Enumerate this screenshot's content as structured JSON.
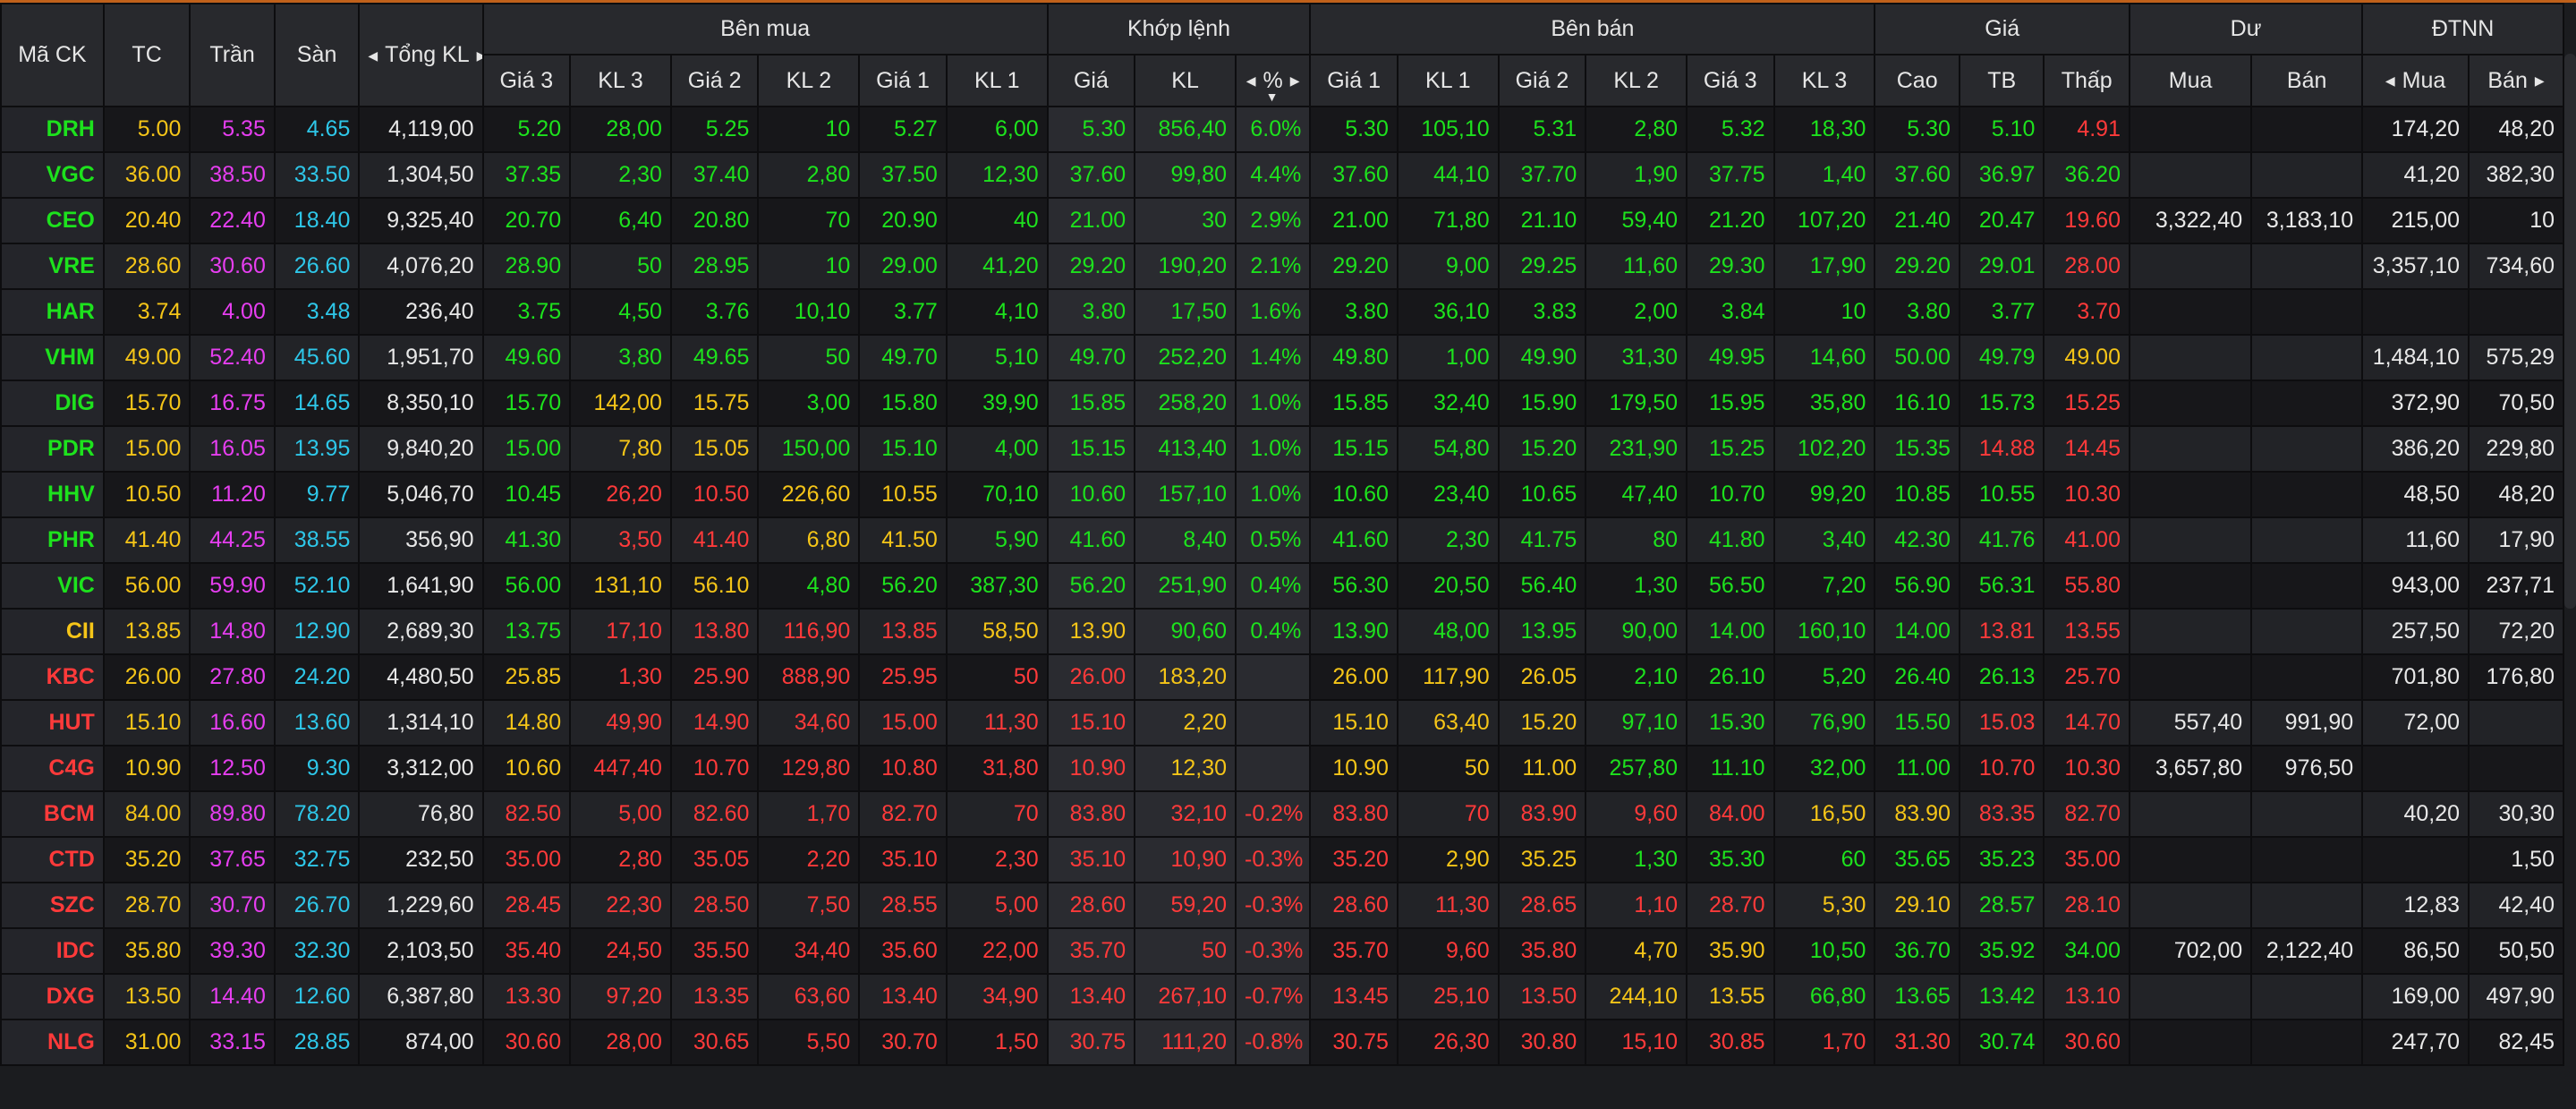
{
  "headers": {
    "symbol": "Mã CK",
    "ref": "TC",
    "ceiling": "Trần",
    "floor": "Sàn",
    "total_vol": "Tổng KL",
    "buy_side": "Bên mua",
    "matched": "Khớp lệnh",
    "sell_side": "Bên bán",
    "price": "Giá",
    "residual": "Dư",
    "foreign": "ĐTNN",
    "buy_cols": [
      "Giá 3",
      "KL 3",
      "Giá 2",
      "KL 2",
      "Giá 1",
      "KL 1"
    ],
    "match_cols": [
      "Giá",
      "KL",
      "%"
    ],
    "sell_cols": [
      "Giá 1",
      "KL 1",
      "Giá 2",
      "KL 2",
      "Giá 3",
      "KL 3"
    ],
    "price_cols": [
      "Cao",
      "TB",
      "Thấp"
    ],
    "residual_cols": [
      "Mua",
      "Bán"
    ],
    "foreign_cols": [
      "Mua",
      "Bán"
    ]
  },
  "icons": {
    "arrow_left": "◀",
    "arrow_right": "▶",
    "sort_down": "▼"
  },
  "colors": {
    "up": "#1de21d",
    "down": "#ff3a3a",
    "reference": "#f5c518",
    "ceiling": "#e63ef0",
    "floor": "#2ec7e9",
    "neutral": "#e8e8e8"
  },
  "rows": [
    {
      "sym": "DRH",
      "tc": "5.00",
      "tran": "5.35",
      "san": "4.65",
      "tong_kl": "4,119,00",
      "b3p": "5.20",
      "b3v": "28,00",
      "b2p": "5.25",
      "b2v": "10",
      "b1p": "5.27",
      "b1v": "6,00",
      "mp": "5.30",
      "mv": "856,40",
      "pct": "6.0%",
      "s1p": "5.30",
      "s1v": "105,10",
      "s2p": "5.31",
      "s2v": "2,80",
      "s3p": "5.32",
      "s3v": "18,30",
      "cao": "5.30",
      "tb": "5.10",
      "thap": "4.91",
      "du_mua": "",
      "du_ban": "",
      "nn_mua": "174,20",
      "nn_ban": "48,20",
      "c": [
        "u",
        "u",
        "u",
        "u",
        "u",
        "u",
        "u",
        "u",
        "u",
        "u",
        "u",
        "u",
        "u",
        "u",
        "u",
        "u",
        "u",
        "d"
      ]
    },
    {
      "sym": "VGC",
      "tc": "36.00",
      "tran": "38.50",
      "san": "33.50",
      "tong_kl": "1,304,50",
      "b3p": "37.35",
      "b3v": "2,30",
      "b2p": "37.40",
      "b2v": "2,80",
      "b1p": "37.50",
      "b1v": "12,30",
      "mp": "37.60",
      "mv": "99,80",
      "pct": "4.4%",
      "s1p": "37.60",
      "s1v": "44,10",
      "s2p": "37.70",
      "s2v": "1,90",
      "s3p": "37.75",
      "s3v": "1,40",
      "cao": "37.60",
      "tb": "36.97",
      "thap": "36.20",
      "du_mua": "",
      "du_ban": "",
      "nn_mua": "41,20",
      "nn_ban": "382,30",
      "c": [
        "u",
        "u",
        "u",
        "u",
        "u",
        "u",
        "u",
        "u",
        "u",
        "u",
        "u",
        "u",
        "u",
        "u",
        "u",
        "u",
        "u",
        "u"
      ]
    },
    {
      "sym": "CEO",
      "tc": "20.40",
      "tran": "22.40",
      "san": "18.40",
      "tong_kl": "9,325,40",
      "b3p": "20.70",
      "b3v": "6,40",
      "b2p": "20.80",
      "b2v": "70",
      "b1p": "20.90",
      "b1v": "40",
      "mp": "21.00",
      "mv": "30",
      "pct": "2.9%",
      "s1p": "21.00",
      "s1v": "71,80",
      "s2p": "21.10",
      "s2v": "59,40",
      "s3p": "21.20",
      "s3v": "107,20",
      "cao": "21.40",
      "tb": "20.47",
      "thap": "19.60",
      "du_mua": "3,322,40",
      "du_ban": "3,183,10",
      "nn_mua": "215,00",
      "nn_ban": "10",
      "c": [
        "u",
        "u",
        "u",
        "u",
        "u",
        "u",
        "u",
        "u",
        "u",
        "u",
        "u",
        "u",
        "u",
        "u",
        "u",
        "u",
        "u",
        "d"
      ]
    },
    {
      "sym": "VRE",
      "tc": "28.60",
      "tran": "30.60",
      "san": "26.60",
      "tong_kl": "4,076,20",
      "b3p": "28.90",
      "b3v": "50",
      "b2p": "28.95",
      "b2v": "10",
      "b1p": "29.00",
      "b1v": "41,20",
      "mp": "29.20",
      "mv": "190,20",
      "pct": "2.1%",
      "s1p": "29.20",
      "s1v": "9,00",
      "s2p": "29.25",
      "s2v": "11,60",
      "s3p": "29.30",
      "s3v": "17,90",
      "cao": "29.20",
      "tb": "29.01",
      "thap": "28.00",
      "du_mua": "",
      "du_ban": "",
      "nn_mua": "3,357,10",
      "nn_ban": "734,60",
      "c": [
        "u",
        "u",
        "u",
        "u",
        "u",
        "u",
        "u",
        "u",
        "u",
        "u",
        "u",
        "u",
        "u",
        "u",
        "u",
        "u",
        "u",
        "d"
      ]
    },
    {
      "sym": "HAR",
      "tc": "3.74",
      "tran": "4.00",
      "san": "3.48",
      "tong_kl": "236,40",
      "b3p": "3.75",
      "b3v": "4,50",
      "b2p": "3.76",
      "b2v": "10,10",
      "b1p": "3.77",
      "b1v": "4,10",
      "mp": "3.80",
      "mv": "17,50",
      "pct": "1.6%",
      "s1p": "3.80",
      "s1v": "36,10",
      "s2p": "3.83",
      "s2v": "2,00",
      "s3p": "3.84",
      "s3v": "10",
      "cao": "3.80",
      "tb": "3.77",
      "thap": "3.70",
      "du_mua": "",
      "du_ban": "",
      "nn_mua": "",
      "nn_ban": "",
      "c": [
        "u",
        "u",
        "u",
        "u",
        "u",
        "u",
        "u",
        "u",
        "u",
        "u",
        "u",
        "u",
        "u",
        "u",
        "u",
        "u",
        "u",
        "d"
      ]
    },
    {
      "sym": "VHM",
      "tc": "49.00",
      "tran": "52.40",
      "san": "45.60",
      "tong_kl": "1,951,70",
      "b3p": "49.60",
      "b3v": "3,80",
      "b2p": "49.65",
      "b2v": "50",
      "b1p": "49.70",
      "b1v": "5,10",
      "mp": "49.70",
      "mv": "252,20",
      "pct": "1.4%",
      "s1p": "49.80",
      "s1v": "1,00",
      "s2p": "49.90",
      "s2v": "31,30",
      "s3p": "49.95",
      "s3v": "14,60",
      "cao": "50.00",
      "tb": "49.79",
      "thap": "49.00",
      "du_mua": "",
      "du_ban": "",
      "nn_mua": "1,484,10",
      "nn_ban": "575,29",
      "c": [
        "u",
        "u",
        "u",
        "u",
        "u",
        "u",
        "u",
        "u",
        "u",
        "u",
        "u",
        "u",
        "u",
        "u",
        "u",
        "u",
        "u",
        "r"
      ]
    },
    {
      "sym": "DIG",
      "tc": "15.70",
      "tran": "16.75",
      "san": "14.65",
      "tong_kl": "8,350,10",
      "b3p": "15.70",
      "b3v": "142,00",
      "b2p": "15.75",
      "b2v": "3,00",
      "b1p": "15.80",
      "b1v": "39,90",
      "mp": "15.85",
      "mv": "258,20",
      "pct": "1.0%",
      "s1p": "15.85",
      "s1v": "32,40",
      "s2p": "15.90",
      "s2v": "179,50",
      "s3p": "15.95",
      "s3v": "35,80",
      "cao": "16.10",
      "tb": "15.73",
      "thap": "15.25",
      "du_mua": "",
      "du_ban": "",
      "nn_mua": "372,90",
      "nn_ban": "70,50",
      "c": [
        "u",
        "r",
        "r",
        "u",
        "u",
        "u",
        "u",
        "u",
        "u",
        "u",
        "u",
        "u",
        "u",
        "u",
        "u",
        "u",
        "u",
        "d"
      ]
    },
    {
      "sym": "PDR",
      "tc": "15.00",
      "tran": "16.05",
      "san": "13.95",
      "tong_kl": "9,840,20",
      "b3p": "15.00",
      "b3v": "7,80",
      "b2p": "15.05",
      "b2v": "150,00",
      "b1p": "15.10",
      "b1v": "4,00",
      "mp": "15.15",
      "mv": "413,40",
      "pct": "1.0%",
      "s1p": "15.15",
      "s1v": "54,80",
      "s2p": "15.20",
      "s2v": "231,90",
      "s3p": "15.25",
      "s3v": "102,20",
      "cao": "15.35",
      "tb": "14.88",
      "thap": "14.45",
      "du_mua": "",
      "du_ban": "",
      "nn_mua": "386,20",
      "nn_ban": "229,80",
      "c": [
        "u",
        "r",
        "r",
        "u",
        "u",
        "u",
        "u",
        "u",
        "u",
        "u",
        "u",
        "u",
        "u",
        "u",
        "u",
        "u",
        "d",
        "d"
      ]
    },
    {
      "sym": "HHV",
      "tc": "10.50",
      "tran": "11.20",
      "san": "9.77",
      "tong_kl": "5,046,70",
      "b3p": "10.45",
      "b3v": "26,20",
      "b2p": "10.50",
      "b2v": "226,60",
      "b1p": "10.55",
      "b1v": "70,10",
      "mp": "10.60",
      "mv": "157,10",
      "pct": "1.0%",
      "s1p": "10.60",
      "s1v": "23,40",
      "s2p": "10.65",
      "s2v": "47,40",
      "s3p": "10.70",
      "s3v": "99,20",
      "cao": "10.85",
      "tb": "10.55",
      "thap": "10.30",
      "du_mua": "",
      "du_ban": "",
      "nn_mua": "48,50",
      "nn_ban": "48,20",
      "c": [
        "u",
        "d",
        "d",
        "r",
        "r",
        "u",
        "u",
        "u",
        "u",
        "u",
        "u",
        "u",
        "u",
        "u",
        "u",
        "u",
        "u",
        "d"
      ]
    },
    {
      "sym": "PHR",
      "tc": "41.40",
      "tran": "44.25",
      "san": "38.55",
      "tong_kl": "356,90",
      "b3p": "41.30",
      "b3v": "3,50",
      "b2p": "41.40",
      "b2v": "6,80",
      "b1p": "41.50",
      "b1v": "5,90",
      "mp": "41.60",
      "mv": "8,40",
      "pct": "0.5%",
      "s1p": "41.60",
      "s1v": "2,30",
      "s2p": "41.75",
      "s2v": "80",
      "s3p": "41.80",
      "s3v": "3,40",
      "cao": "42.30",
      "tb": "41.76",
      "thap": "41.00",
      "du_mua": "",
      "du_ban": "",
      "nn_mua": "11,60",
      "nn_ban": "17,90",
      "c": [
        "u",
        "d",
        "d",
        "r",
        "r",
        "u",
        "u",
        "u",
        "u",
        "u",
        "u",
        "u",
        "u",
        "u",
        "u",
        "u",
        "u",
        "d"
      ]
    },
    {
      "sym": "VIC",
      "tc": "56.00",
      "tran": "59.90",
      "san": "52.10",
      "tong_kl": "1,641,90",
      "b3p": "56.00",
      "b3v": "131,10",
      "b2p": "56.10",
      "b2v": "4,80",
      "b1p": "56.20",
      "b1v": "387,30",
      "mp": "56.20",
      "mv": "251,90",
      "pct": "0.4%",
      "s1p": "56.30",
      "s1v": "20,50",
      "s2p": "56.40",
      "s2v": "1,30",
      "s3p": "56.50",
      "s3v": "7,20",
      "cao": "56.90",
      "tb": "56.31",
      "thap": "55.80",
      "du_mua": "",
      "du_ban": "",
      "nn_mua": "943,00",
      "nn_ban": "237,71",
      "c": [
        "u",
        "r",
        "r",
        "u",
        "u",
        "u",
        "u",
        "u",
        "u",
        "u",
        "u",
        "u",
        "u",
        "u",
        "u",
        "u",
        "u",
        "d"
      ]
    },
    {
      "sym": "CII",
      "tc": "13.85",
      "tran": "14.80",
      "san": "12.90",
      "tong_kl": "2,689,30",
      "b3p": "13.75",
      "b3v": "17,10",
      "b2p": "13.80",
      "b2v": "116,90",
      "b1p": "13.85",
      "b1v": "58,50",
      "mp": "13.90",
      "mv": "90,60",
      "pct": "0.4%",
      "s1p": "13.90",
      "s1v": "48,00",
      "s2p": "13.95",
      "s2v": "90,00",
      "s3p": "14.00",
      "s3v": "160,10",
      "cao": "14.00",
      "tb": "13.81",
      "thap": "13.55",
      "du_mua": "",
      "du_ban": "",
      "nn_mua": "257,50",
      "nn_ban": "72,20",
      "c": [
        "u",
        "d",
        "d",
        "d",
        "d",
        "r",
        "r",
        "u",
        "u",
        "u",
        "u",
        "u",
        "u",
        "u",
        "u",
        "u",
        "d",
        "d"
      ]
    },
    {
      "sym": "KBC",
      "tc": "26.00",
      "tran": "27.80",
      "san": "24.20",
      "tong_kl": "4,480,50",
      "b3p": "25.85",
      "b3v": "1,30",
      "b2p": "25.90",
      "b2v": "888,90",
      "b1p": "25.95",
      "b1v": "50",
      "mp": "26.00",
      "mv": "183,20",
      "pct": "",
      "s1p": "26.00",
      "s1v": "117,90",
      "s2p": "26.05",
      "s2v": "2,10",
      "s3p": "26.10",
      "s3v": "5,20",
      "cao": "26.40",
      "tb": "26.13",
      "thap": "25.70",
      "du_mua": "",
      "du_ban": "",
      "nn_mua": "701,80",
      "nn_ban": "176,80",
      "c": [
        "r",
        "d",
        "d",
        "d",
        "d",
        "d",
        "d",
        "r",
        "r",
        "r",
        "r",
        "r",
        "u",
        "u",
        "u",
        "u",
        "u",
        "d"
      ]
    },
    {
      "sym": "HUT",
      "tc": "15.10",
      "tran": "16.60",
      "san": "13.60",
      "tong_kl": "1,314,10",
      "b3p": "14.80",
      "b3v": "49,90",
      "b2p": "14.90",
      "b2v": "34,60",
      "b1p": "15.00",
      "b1v": "11,30",
      "mp": "15.10",
      "mv": "2,20",
      "pct": "",
      "s1p": "15.10",
      "s1v": "63,40",
      "s2p": "15.20",
      "s2v": "97,10",
      "s3p": "15.30",
      "s3v": "76,90",
      "cao": "15.50",
      "tb": "15.03",
      "thap": "14.70",
      "du_mua": "557,40",
      "du_ban": "991,90",
      "nn_mua": "72,00",
      "nn_ban": "",
      "c": [
        "r",
        "d",
        "d",
        "d",
        "d",
        "d",
        "d",
        "r",
        "r",
        "r",
        "r",
        "r",
        "u",
        "u",
        "u",
        "u",
        "d",
        "d"
      ]
    },
    {
      "sym": "C4G",
      "tc": "10.90",
      "tran": "12.50",
      "san": "9.30",
      "tong_kl": "3,312,00",
      "b3p": "10.60",
      "b3v": "447,40",
      "b2p": "10.70",
      "b2v": "129,80",
      "b1p": "10.80",
      "b1v": "31,80",
      "mp": "10.90",
      "mv": "12,30",
      "pct": "",
      "s1p": "10.90",
      "s1v": "50",
      "s2p": "11.00",
      "s2v": "257,80",
      "s3p": "11.10",
      "s3v": "32,00",
      "cao": "11.00",
      "tb": "10.70",
      "thap": "10.30",
      "du_mua": "3,657,80",
      "du_ban": "976,50",
      "nn_mua": "",
      "nn_ban": "",
      "c": [
        "r",
        "d",
        "d",
        "d",
        "d",
        "d",
        "d",
        "r",
        "r",
        "r",
        "r",
        "r",
        "u",
        "u",
        "u",
        "u",
        "d",
        "d"
      ]
    },
    {
      "sym": "BCM",
      "tc": "84.00",
      "tran": "89.80",
      "san": "78.20",
      "tong_kl": "76,80",
      "b3p": "82.50",
      "b3v": "5,00",
      "b2p": "82.60",
      "b2v": "1,70",
      "b1p": "82.70",
      "b1v": "70",
      "mp": "83.80",
      "mv": "32,10",
      "pct": "-0.2%",
      "s1p": "83.80",
      "s1v": "70",
      "s2p": "83.90",
      "s2v": "9,60",
      "s3p": "84.00",
      "s3v": "16,50",
      "cao": "83.90",
      "tb": "83.35",
      "thap": "82.70",
      "du_mua": "",
      "du_ban": "",
      "nn_mua": "40,20",
      "nn_ban": "30,30",
      "c": [
        "d",
        "d",
        "d",
        "d",
        "d",
        "d",
        "d",
        "d",
        "d",
        "d",
        "d",
        "d",
        "d",
        "d",
        "r",
        "r",
        "d",
        "d"
      ]
    },
    {
      "sym": "CTD",
      "tc": "35.20",
      "tran": "37.65",
      "san": "32.75",
      "tong_kl": "232,50",
      "b3p": "35.00",
      "b3v": "2,80",
      "b2p": "35.05",
      "b2v": "2,20",
      "b1p": "35.10",
      "b1v": "2,30",
      "mp": "35.10",
      "mv": "10,90",
      "pct": "-0.3%",
      "s1p": "35.20",
      "s1v": "2,90",
      "s2p": "35.25",
      "s2v": "1,30",
      "s3p": "35.30",
      "s3v": "60",
      "cao": "35.65",
      "tb": "35.23",
      "thap": "35.00",
      "du_mua": "",
      "du_ban": "",
      "nn_mua": "",
      "nn_ban": "1,50",
      "c": [
        "d",
        "d",
        "d",
        "d",
        "d",
        "d",
        "d",
        "d",
        "d",
        "d",
        "r",
        "r",
        "u",
        "u",
        "u",
        "u",
        "u",
        "d"
      ]
    },
    {
      "sym": "SZC",
      "tc": "28.70",
      "tran": "30.70",
      "san": "26.70",
      "tong_kl": "1,229,60",
      "b3p": "28.45",
      "b3v": "22,30",
      "b2p": "28.50",
      "b2v": "7,50",
      "b1p": "28.55",
      "b1v": "5,00",
      "mp": "28.60",
      "mv": "59,20",
      "pct": "-0.3%",
      "s1p": "28.60",
      "s1v": "11,30",
      "s2p": "28.65",
      "s2v": "1,10",
      "s3p": "28.70",
      "s3v": "5,30",
      "cao": "29.10",
      "tb": "28.57",
      "thap": "28.10",
      "du_mua": "",
      "du_ban": "",
      "nn_mua": "12,83",
      "nn_ban": "42,40",
      "c": [
        "d",
        "d",
        "d",
        "d",
        "d",
        "d",
        "d",
        "d",
        "d",
        "d",
        "d",
        "d",
        "d",
        "d",
        "r",
        "r",
        "u",
        "d"
      ]
    },
    {
      "sym": "IDC",
      "tc": "35.80",
      "tran": "39.30",
      "san": "32.30",
      "tong_kl": "2,103,50",
      "b3p": "35.40",
      "b3v": "24,50",
      "b2p": "35.50",
      "b2v": "34,40",
      "b1p": "35.60",
      "b1v": "22,00",
      "mp": "35.70",
      "mv": "50",
      "pct": "-0.3%",
      "s1p": "35.70",
      "s1v": "9,60",
      "s2p": "35.80",
      "s2v": "4,70",
      "s3p": "35.90",
      "s3v": "10,50",
      "cao": "36.70",
      "tb": "35.92",
      "thap": "34.00",
      "du_mua": "702,00",
      "du_ban": "2,122,40",
      "nn_mua": "86,50",
      "nn_ban": "50,50",
      "c": [
        "d",
        "d",
        "d",
        "d",
        "d",
        "d",
        "d",
        "d",
        "d",
        "d",
        "d",
        "d",
        "r",
        "r",
        "u",
        "u",
        "u",
        "u",
        "d"
      ]
    },
    {
      "sym": "DXG",
      "tc": "13.50",
      "tran": "14.40",
      "san": "12.60",
      "tong_kl": "6,387,80",
      "b3p": "13.30",
      "b3v": "97,20",
      "b2p": "13.35",
      "b2v": "63,60",
      "b1p": "13.40",
      "b1v": "34,90",
      "mp": "13.40",
      "mv": "267,10",
      "pct": "-0.7%",
      "s1p": "13.45",
      "s1v": "25,10",
      "s2p": "13.50",
      "s2v": "244,10",
      "s3p": "13.55",
      "s3v": "66,80",
      "cao": "13.65",
      "tb": "13.42",
      "thap": "13.10",
      "du_mua": "",
      "du_ban": "",
      "nn_mua": "169,00",
      "nn_ban": "497,90",
      "c": [
        "d",
        "d",
        "d",
        "d",
        "d",
        "d",
        "d",
        "d",
        "d",
        "d",
        "d",
        "d",
        "r",
        "r",
        "u",
        "u",
        "u",
        "d",
        "d"
      ]
    },
    {
      "sym": "NLG",
      "tc": "31.00",
      "tran": "33.15",
      "san": "28.85",
      "tong_kl": "874,00",
      "b3p": "30.60",
      "b3v": "28,00",
      "b2p": "30.65",
      "b2v": "5,50",
      "b1p": "30.70",
      "b1v": "1,50",
      "mp": "30.75",
      "mv": "111,20",
      "pct": "-0.8%",
      "s1p": "30.75",
      "s1v": "26,30",
      "s2p": "30.80",
      "s2v": "15,10",
      "s3p": "30.85",
      "s3v": "1,70",
      "cao": "31.30",
      "tb": "30.74",
      "thap": "30.60",
      "du_mua": "",
      "du_ban": "",
      "nn_mua": "247,70",
      "nn_ban": "82,45",
      "c": [
        "d",
        "d",
        "d",
        "d",
        "d",
        "d",
        "d",
        "d",
        "d",
        "d",
        "d",
        "d",
        "d",
        "d",
        "d",
        "d",
        "u",
        "d",
        "d"
      ]
    }
  ]
}
